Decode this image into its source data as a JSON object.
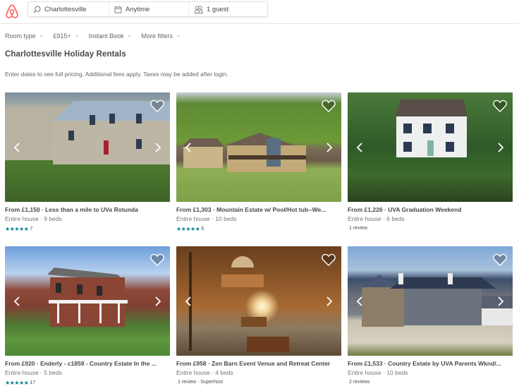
{
  "header": {
    "logo": "airbnb-logo",
    "search": {
      "location": "Charlottesville",
      "dates": "Anytime",
      "guests": "1 guest",
      "icons": {
        "location": "search-icon",
        "dates": "calendar-icon",
        "guests": "guests-icon"
      }
    }
  },
  "filters": [
    {
      "label": "Room type"
    },
    {
      "label": "£915+"
    },
    {
      "label": "Instant Book"
    },
    {
      "label": "More filters"
    }
  ],
  "page": {
    "title": "Charlottesville Holiday Rentals",
    "note": "Enter dates to see full pricing. Additional fees apply. Taxes may be added after login."
  },
  "colors": {
    "brand": "#FF5A5F",
    "stars": "#008489",
    "text": "#484848",
    "muted": "#767676"
  },
  "listings": [
    {
      "title": "From £1,150 · Less than a mile to UVa Rotunda",
      "subtitle": "Entire house · 9 beds",
      "rating_stars": 5,
      "stars_text": "★★★★★",
      "meta": "7"
    },
    {
      "title": "From £1,303 · Mountain Estate w/ Pool/Hot tub--We...",
      "subtitle": "Entire house · 10 beds",
      "rating_stars": 5,
      "stars_text": "★★★★★",
      "meta": "5"
    },
    {
      "title": "From £1,226 · UVA Graduation Weekend",
      "subtitle": "Entire house · 6 beds",
      "rating_stars": null,
      "stars_text": "",
      "meta": "1 review"
    },
    {
      "title": "From £920 · Enderly - c1859 - Country Estate In the ...",
      "subtitle": "Entire house · 5 beds",
      "rating_stars": 5,
      "stars_text": "★★★★★",
      "meta": "17"
    },
    {
      "title": "From £958 · Zen Barn Event Venue and Retreat Center",
      "subtitle": "Entire house · 4 beds",
      "rating_stars": null,
      "stars_text": "",
      "meta": "1 review · Superhost"
    },
    {
      "title": "From £1,533 · Country Estate by UVA Parents Wknd/...",
      "subtitle": "Entire house · 10 beds",
      "rating_stars": null,
      "stars_text": "",
      "meta": "2 reviews"
    }
  ]
}
